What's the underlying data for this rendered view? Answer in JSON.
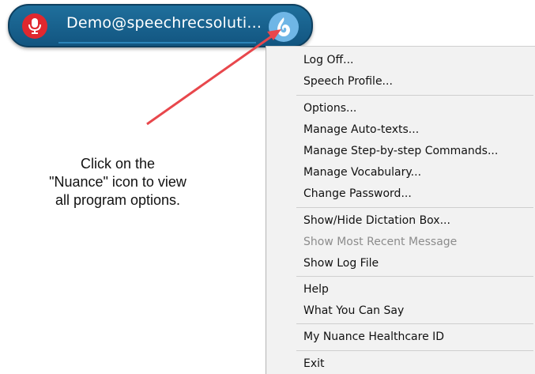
{
  "toolbar": {
    "user_name": "Demo@speechrecsoluti...",
    "mic_icon": "microphone-icon",
    "nuance_icon": "nuance-flame-icon",
    "bar_color": "#1a6493",
    "mic_color": "#e0282f"
  },
  "menu": {
    "items": [
      {
        "label": "Log Off..."
      },
      {
        "label": "Speech Profile..."
      },
      {
        "label": "Options..."
      },
      {
        "label": "Manage Auto-texts..."
      },
      {
        "label": "Manage Step-by-step Commands..."
      },
      {
        "label": "Manage Vocabulary..."
      },
      {
        "label": "Change Password..."
      },
      {
        "label": "Show/Hide Dictation Box..."
      },
      {
        "label": "Show Most Recent Message",
        "disabled": true
      },
      {
        "label": "Show Log File"
      },
      {
        "label": "Help"
      },
      {
        "label": "What You Can Say"
      },
      {
        "label": "My Nuance Healthcare ID"
      },
      {
        "label": "Exit"
      }
    ]
  },
  "annotation": {
    "line1": "Click on the",
    "line2": "\"Nuance\" icon to view",
    "line3": "all program options.",
    "arrow_color": "#e8474c"
  }
}
